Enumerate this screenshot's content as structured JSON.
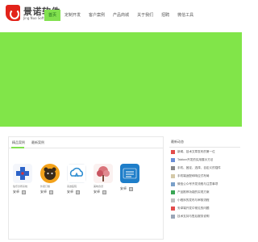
{
  "brand": {
    "name": "景诺软件",
    "tagline": "Jing Nuo Software",
    "logo_color": "#e2231a"
  },
  "nav": {
    "items": [
      {
        "label": "首页",
        "active": true
      },
      {
        "label": "定制开发",
        "active": false
      },
      {
        "label": "客户案例",
        "active": false
      },
      {
        "label": "产品商城",
        "active": false
      },
      {
        "label": "关于我们",
        "active": false
      },
      {
        "label": "招聘",
        "active": false
      },
      {
        "label": "微信工具",
        "active": false
      }
    ]
  },
  "hero": {
    "color": "#81e549"
  },
  "products": {
    "tabs": [
      "精品案例",
      "最新案例"
    ],
    "items": [
      {
        "name": "伯乐诊所系统",
        "badge": "安卓",
        "icon": "medical-cross-icon"
      },
      {
        "name": "外卖订餐",
        "badge": "安卓",
        "icon": "bear-food-icon"
      },
      {
        "name": "墨迹医院",
        "badge": "安卓",
        "icon": "cloud-leaf-icon"
      },
      {
        "name": "美味食谱",
        "badge": "安卓",
        "icon": "tree-icon"
      },
      {
        "name": "",
        "badge": "安卓",
        "icon": "calligraphy-icon",
        "icon_text": "小书\n小程序"
      }
    ]
  },
  "news": {
    "title": "最新动态",
    "items": [
      {
        "text": "新闻、技术文章发布的第一位"
      },
      {
        "text": "Tabbar开发的实用展示方法"
      },
      {
        "text": "手机、固定、选择、自定义的插件"
      },
      {
        "text": "手机端适配和响应式布局"
      },
      {
        "text": "微信公众号开发流程与注意事项"
      },
      {
        "text": "产品推荐功能的实现方案"
      },
      {
        "text": "小程序的发布与审核流程"
      },
      {
        "text": "安卓端开发中常见的问题"
      },
      {
        "text": "技术支持与售后服务说明"
      }
    ]
  }
}
